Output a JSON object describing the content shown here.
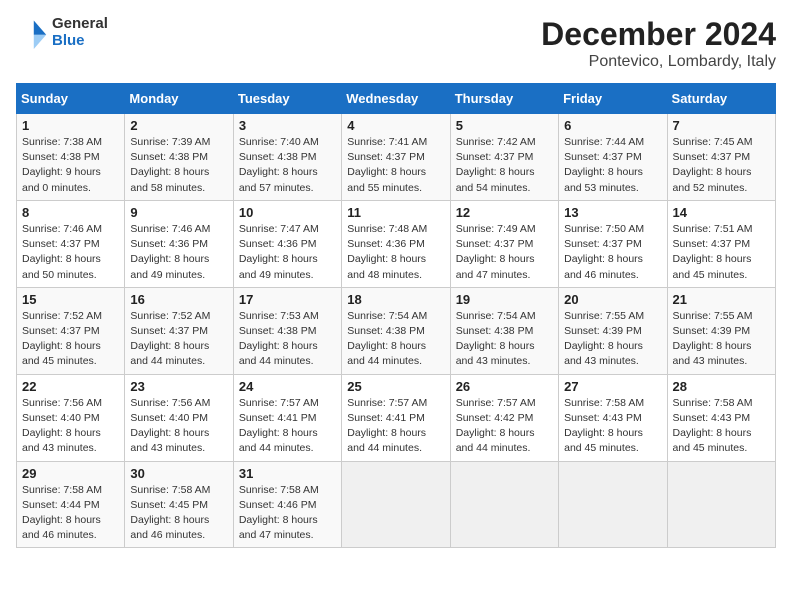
{
  "header": {
    "logo_general": "General",
    "logo_blue": "Blue",
    "title": "December 2024",
    "subtitle": "Pontevico, Lombardy, Italy"
  },
  "columns": [
    "Sunday",
    "Monday",
    "Tuesday",
    "Wednesday",
    "Thursday",
    "Friday",
    "Saturday"
  ],
  "weeks": [
    [
      {
        "day": "1",
        "sunrise": "Sunrise: 7:38 AM",
        "sunset": "Sunset: 4:38 PM",
        "daylight": "Daylight: 9 hours and 0 minutes."
      },
      {
        "day": "2",
        "sunrise": "Sunrise: 7:39 AM",
        "sunset": "Sunset: 4:38 PM",
        "daylight": "Daylight: 8 hours and 58 minutes."
      },
      {
        "day": "3",
        "sunrise": "Sunrise: 7:40 AM",
        "sunset": "Sunset: 4:38 PM",
        "daylight": "Daylight: 8 hours and 57 minutes."
      },
      {
        "day": "4",
        "sunrise": "Sunrise: 7:41 AM",
        "sunset": "Sunset: 4:37 PM",
        "daylight": "Daylight: 8 hours and 55 minutes."
      },
      {
        "day": "5",
        "sunrise": "Sunrise: 7:42 AM",
        "sunset": "Sunset: 4:37 PM",
        "daylight": "Daylight: 8 hours and 54 minutes."
      },
      {
        "day": "6",
        "sunrise": "Sunrise: 7:44 AM",
        "sunset": "Sunset: 4:37 PM",
        "daylight": "Daylight: 8 hours and 53 minutes."
      },
      {
        "day": "7",
        "sunrise": "Sunrise: 7:45 AM",
        "sunset": "Sunset: 4:37 PM",
        "daylight": "Daylight: 8 hours and 52 minutes."
      }
    ],
    [
      {
        "day": "8",
        "sunrise": "Sunrise: 7:46 AM",
        "sunset": "Sunset: 4:37 PM",
        "daylight": "Daylight: 8 hours and 50 minutes."
      },
      {
        "day": "9",
        "sunrise": "Sunrise: 7:46 AM",
        "sunset": "Sunset: 4:36 PM",
        "daylight": "Daylight: 8 hours and 49 minutes."
      },
      {
        "day": "10",
        "sunrise": "Sunrise: 7:47 AM",
        "sunset": "Sunset: 4:36 PM",
        "daylight": "Daylight: 8 hours and 49 minutes."
      },
      {
        "day": "11",
        "sunrise": "Sunrise: 7:48 AM",
        "sunset": "Sunset: 4:36 PM",
        "daylight": "Daylight: 8 hours and 48 minutes."
      },
      {
        "day": "12",
        "sunrise": "Sunrise: 7:49 AM",
        "sunset": "Sunset: 4:37 PM",
        "daylight": "Daylight: 8 hours and 47 minutes."
      },
      {
        "day": "13",
        "sunrise": "Sunrise: 7:50 AM",
        "sunset": "Sunset: 4:37 PM",
        "daylight": "Daylight: 8 hours and 46 minutes."
      },
      {
        "day": "14",
        "sunrise": "Sunrise: 7:51 AM",
        "sunset": "Sunset: 4:37 PM",
        "daylight": "Daylight: 8 hours and 45 minutes."
      }
    ],
    [
      {
        "day": "15",
        "sunrise": "Sunrise: 7:52 AM",
        "sunset": "Sunset: 4:37 PM",
        "daylight": "Daylight: 8 hours and 45 minutes."
      },
      {
        "day": "16",
        "sunrise": "Sunrise: 7:52 AM",
        "sunset": "Sunset: 4:37 PM",
        "daylight": "Daylight: 8 hours and 44 minutes."
      },
      {
        "day": "17",
        "sunrise": "Sunrise: 7:53 AM",
        "sunset": "Sunset: 4:38 PM",
        "daylight": "Daylight: 8 hours and 44 minutes."
      },
      {
        "day": "18",
        "sunrise": "Sunrise: 7:54 AM",
        "sunset": "Sunset: 4:38 PM",
        "daylight": "Daylight: 8 hours and 44 minutes."
      },
      {
        "day": "19",
        "sunrise": "Sunrise: 7:54 AM",
        "sunset": "Sunset: 4:38 PM",
        "daylight": "Daylight: 8 hours and 43 minutes."
      },
      {
        "day": "20",
        "sunrise": "Sunrise: 7:55 AM",
        "sunset": "Sunset: 4:39 PM",
        "daylight": "Daylight: 8 hours and 43 minutes."
      },
      {
        "day": "21",
        "sunrise": "Sunrise: 7:55 AM",
        "sunset": "Sunset: 4:39 PM",
        "daylight": "Daylight: 8 hours and 43 minutes."
      }
    ],
    [
      {
        "day": "22",
        "sunrise": "Sunrise: 7:56 AM",
        "sunset": "Sunset: 4:40 PM",
        "daylight": "Daylight: 8 hours and 43 minutes."
      },
      {
        "day": "23",
        "sunrise": "Sunrise: 7:56 AM",
        "sunset": "Sunset: 4:40 PM",
        "daylight": "Daylight: 8 hours and 43 minutes."
      },
      {
        "day": "24",
        "sunrise": "Sunrise: 7:57 AM",
        "sunset": "Sunset: 4:41 PM",
        "daylight": "Daylight: 8 hours and 44 minutes."
      },
      {
        "day": "25",
        "sunrise": "Sunrise: 7:57 AM",
        "sunset": "Sunset: 4:41 PM",
        "daylight": "Daylight: 8 hours and 44 minutes."
      },
      {
        "day": "26",
        "sunrise": "Sunrise: 7:57 AM",
        "sunset": "Sunset: 4:42 PM",
        "daylight": "Daylight: 8 hours and 44 minutes."
      },
      {
        "day": "27",
        "sunrise": "Sunrise: 7:58 AM",
        "sunset": "Sunset: 4:43 PM",
        "daylight": "Daylight: 8 hours and 45 minutes."
      },
      {
        "day": "28",
        "sunrise": "Sunrise: 7:58 AM",
        "sunset": "Sunset: 4:43 PM",
        "daylight": "Daylight: 8 hours and 45 minutes."
      }
    ],
    [
      {
        "day": "29",
        "sunrise": "Sunrise: 7:58 AM",
        "sunset": "Sunset: 4:44 PM",
        "daylight": "Daylight: 8 hours and 46 minutes."
      },
      {
        "day": "30",
        "sunrise": "Sunrise: 7:58 AM",
        "sunset": "Sunset: 4:45 PM",
        "daylight": "Daylight: 8 hours and 46 minutes."
      },
      {
        "day": "31",
        "sunrise": "Sunrise: 7:58 AM",
        "sunset": "Sunset: 4:46 PM",
        "daylight": "Daylight: 8 hours and 47 minutes."
      },
      null,
      null,
      null,
      null
    ]
  ]
}
